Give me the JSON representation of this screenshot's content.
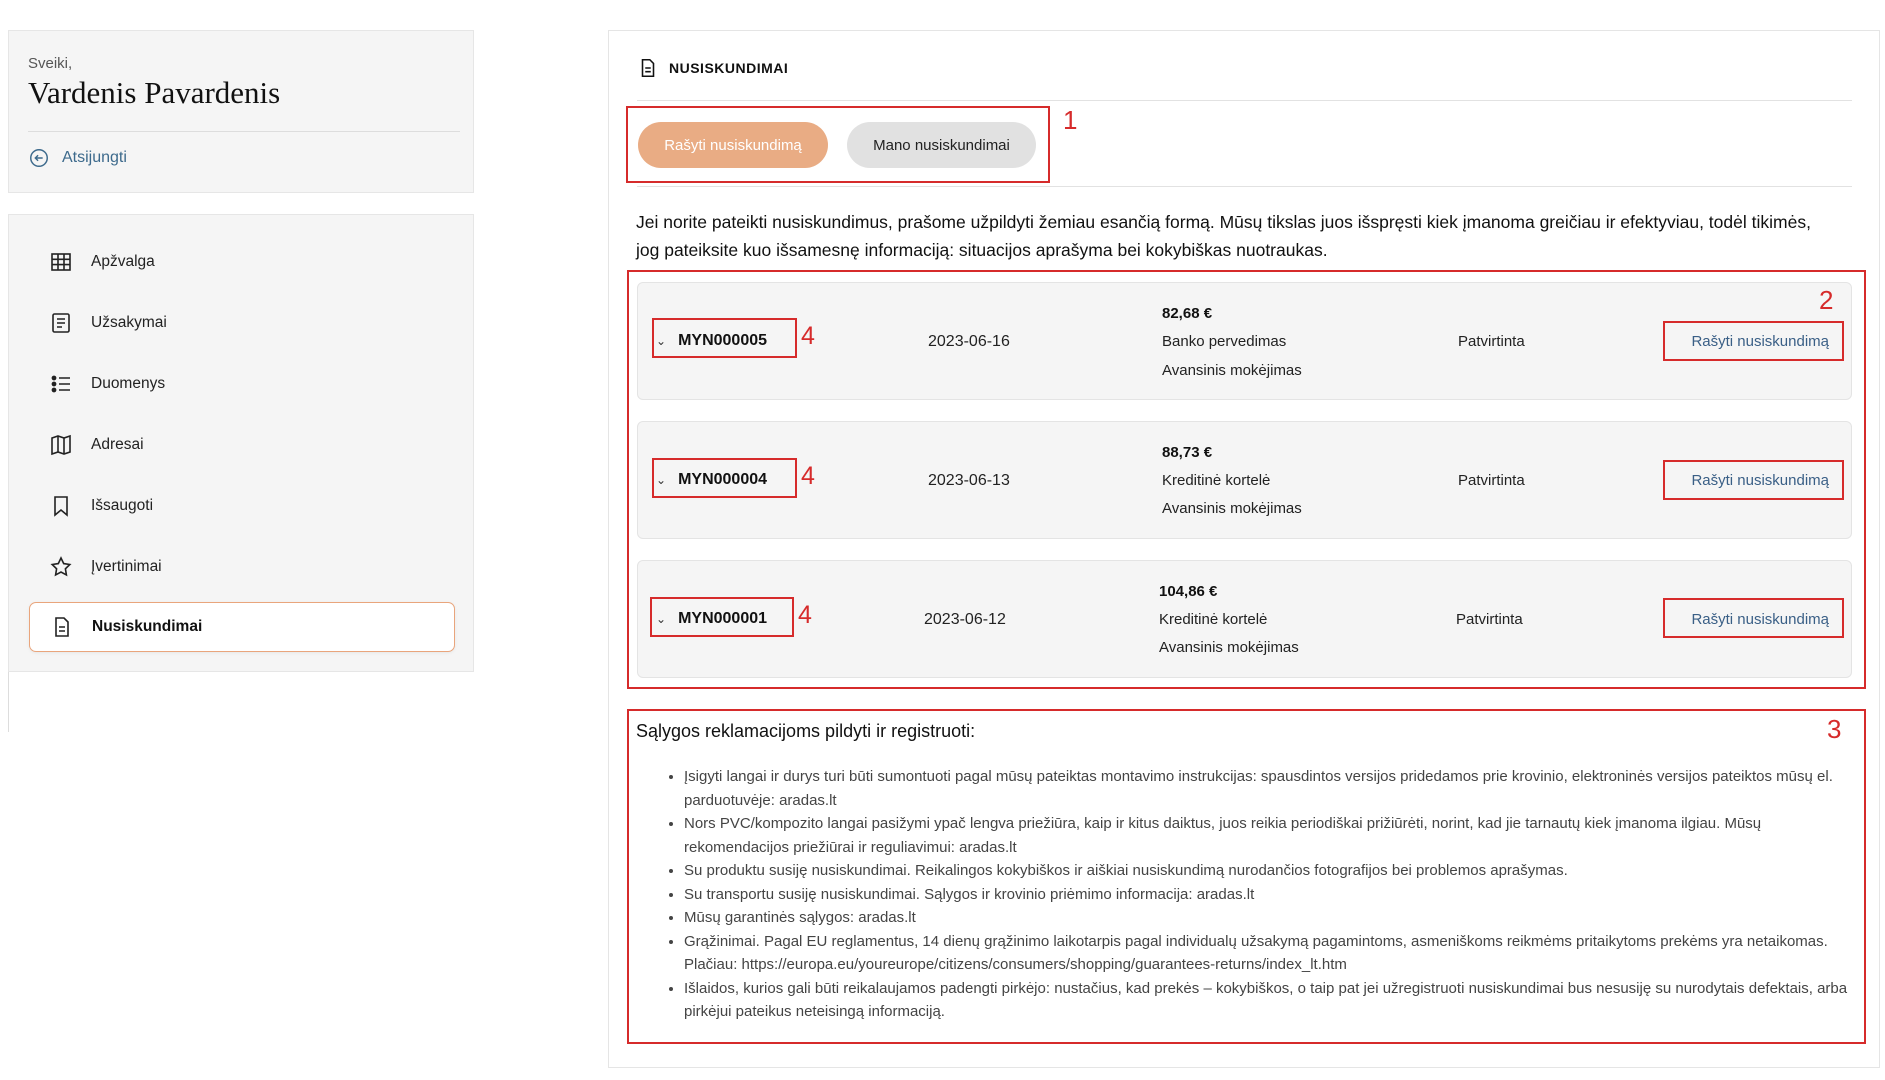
{
  "sidebar": {
    "greeting": "Sveiki,",
    "user_name": "Vardenis Pavardenis",
    "logout_label": "Atsijungti",
    "items": [
      {
        "label": "Apžvalga",
        "icon": "table-grid-icon"
      },
      {
        "label": "Užsakymai",
        "icon": "orders-list-icon"
      },
      {
        "label": "Duomenys",
        "icon": "data-list-icon"
      },
      {
        "label": "Adresai",
        "icon": "map-icon"
      },
      {
        "label": "Išsaugoti",
        "icon": "bookmark-icon"
      },
      {
        "label": "Įvertinimai",
        "icon": "star-icon"
      },
      {
        "label": "Nusiskundimai",
        "icon": "document-icon",
        "active": true
      }
    ]
  },
  "main": {
    "section_title": "NUSISKUNDIMAI",
    "tabs": {
      "write": "Rašyti nusiskundimą",
      "mine": "Mano nusiskundimai"
    },
    "intro": "Jei norite pateikti nusiskundimus, prašome užpildyti žemiau esančią formą. Mūsų tikslas juos išspręsti kiek įmanoma greičiau ir efektyviau, todėl tikimės, jog pateiksite kuo išsamesnę informaciją: situacijos aprašyma bei kokybiškas nuotraukas.",
    "orders": [
      {
        "id": "MYN000005",
        "date": "2023-06-16",
        "amount": "82,68 €",
        "payment": "Banko pervedimas",
        "payment_type": "Avansinis mokėjimas",
        "status": "Patvirtinta",
        "action": "Rašyti nusiskundimą"
      },
      {
        "id": "MYN000004",
        "date": "2023-06-13",
        "amount": "88,73 €",
        "payment": "Kreditinė kortelė",
        "payment_type": "Avansinis mokėjimas",
        "status": "Patvirtinta",
        "action": "Rašyti nusiskundimą"
      },
      {
        "id": "MYN000001",
        "date": "2023-06-12",
        "amount": "104,86 €",
        "payment": "Kreditinė kortelė",
        "payment_type": "Avansinis mokėjimas",
        "status": "Patvirtinta",
        "action": "Rašyti nusiskundimą"
      }
    ],
    "terms_title": "Sąlygos reklamacijoms pildyti ir registruoti:",
    "terms": [
      "Įsigyti langai ir durys turi būti sumontuoti pagal mūsų pateiktas montavimo instrukcijas: spausdintos versijos pridedamos prie krovinio, elektroninės versijos pateiktos mūsų el. parduotuvėje: aradas.lt",
      "Nors PVC/kompozito langai pasižymi ypač lengva priežiūra, kaip ir kitus daiktus, juos reikia periodiškai prižiūrėti, norint, kad jie tarnautų kiek įmanoma ilgiau. Mūsų rekomendacijos priežiūrai ir reguliavimui: aradas.lt",
      "Su produktu susiję nusiskundimai. Reikalingos kokybiškos ir aiškiai nusiskundimą nurodančios fotografijos bei problemos aprašymas.",
      "Su transportu susiję nusiskundimai. Sąlygos ir krovinio priėmimo informacija: aradas.lt",
      "Mūsų garantinės sąlygos: aradas.lt",
      "Grąžinimai. Pagal EU reglamentus, 14 dienų grąžinimo laikotarpis pagal individualų užsakymą pagamintoms, asmeniškoms reikmėms pritaikytoms prekėms yra netaikomas. Plačiau: https://europa.eu/youreurope/citizens/consumers/shopping/guarantees-returns/index_lt.htm",
      "Išlaidos, kurios gali būti reikalaujamos padengti pirkėjo: nustačius, kad prekės – kokybiškos, o taip pat jei užregistruoti nusiskundimai bus nesusiję su nurodytais defektais, arba pirkėjui pateikus neteisingą informaciją."
    ]
  },
  "annotations": [
    "1",
    "2",
    "3",
    "4",
    "4",
    "4"
  ],
  "colors": {
    "accent": "#e9ac84",
    "link": "#3a5f86",
    "annotation": "#d62b2b"
  }
}
